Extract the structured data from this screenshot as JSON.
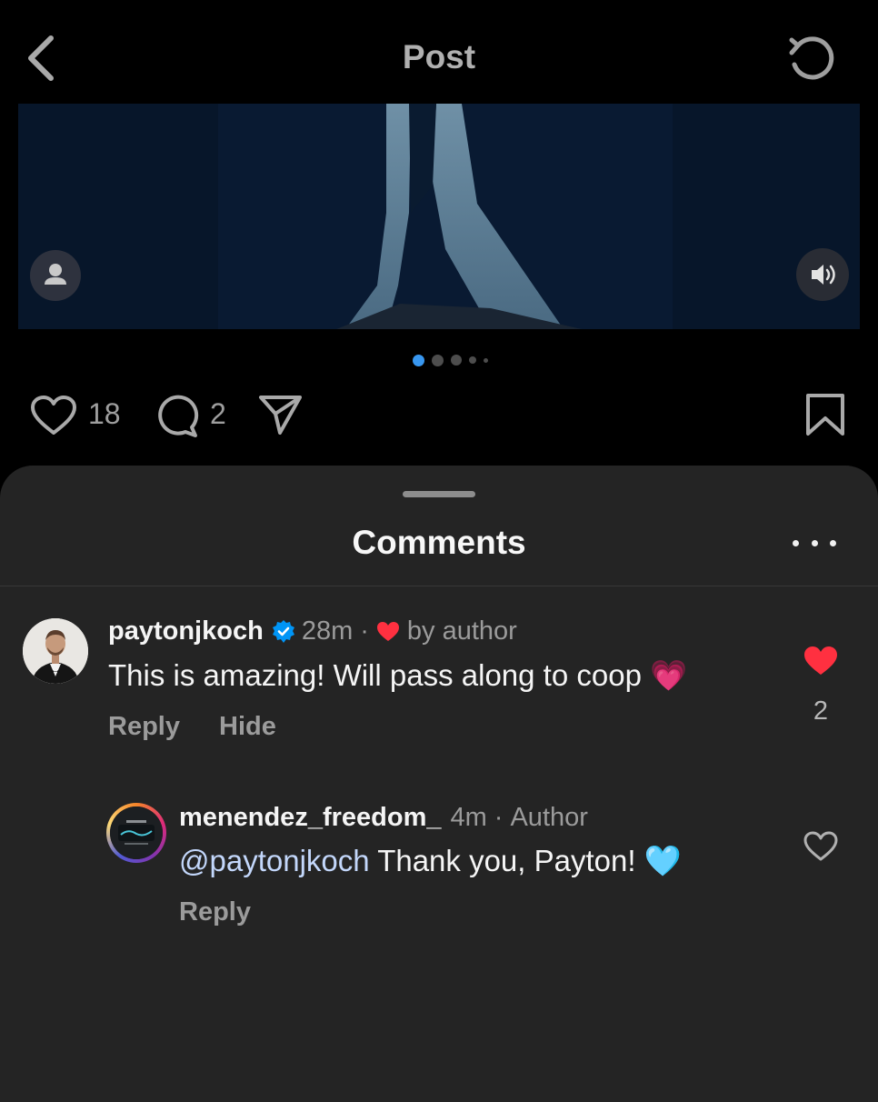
{
  "header": {
    "title": "Post",
    "back_icon": "chevron-left-icon",
    "refresh_icon": "refresh-icon"
  },
  "media": {
    "carousel_pages": 5,
    "carousel_active": 1,
    "accent": "#3897f0"
  },
  "actions": {
    "like_count": "18",
    "comment_count": "2"
  },
  "comments_sheet": {
    "title": "Comments",
    "comments": [
      {
        "username": "paytonjkoch",
        "verified": true,
        "time": "28m",
        "liked_by_author": "by author",
        "text": "This is amazing! Will pass along to coop 💗",
        "reply_label": "Reply",
        "hide_label": "Hide",
        "like_count": "2",
        "liked": true
      },
      {
        "username": "menendez_freedom_",
        "time": "4m",
        "author_badge": "Author",
        "mention": "@paytonjkoch",
        "text": " Thank you, Payton! 🩵",
        "reply_label": "Reply",
        "liked": false
      }
    ]
  },
  "colors": {
    "like_red": "#ff3040",
    "verified_blue": "#0095f6",
    "mention_blue": "#c3d7fb"
  }
}
